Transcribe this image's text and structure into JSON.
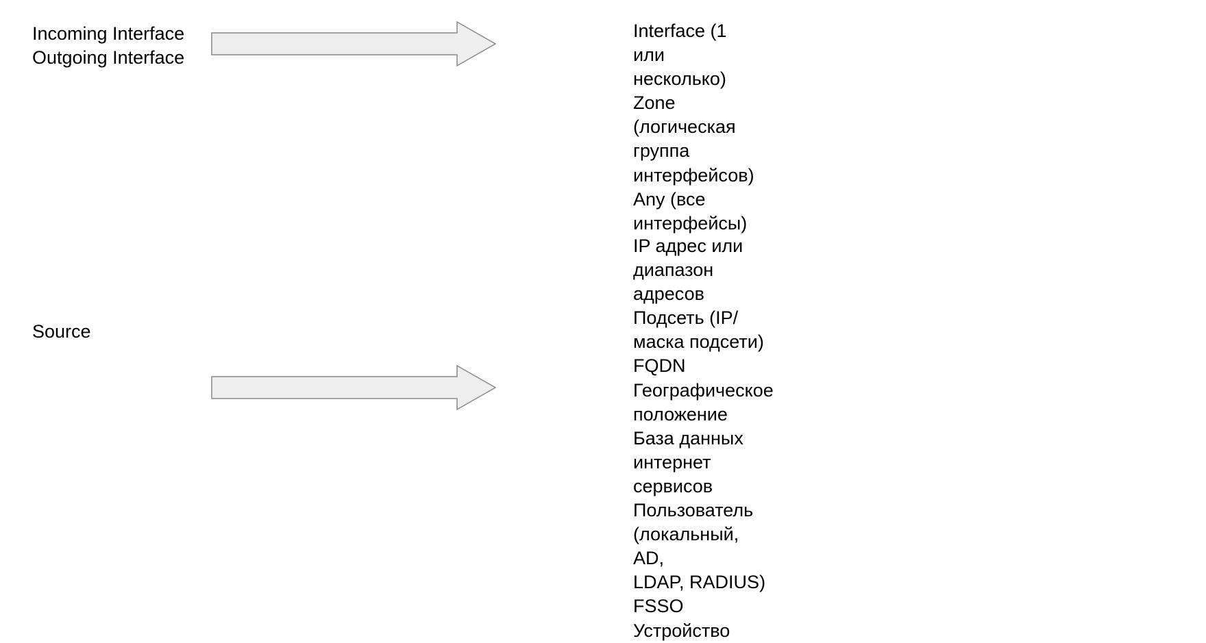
{
  "section1": {
    "left": {
      "line1": "Incoming Interface",
      "line2": "Outgoing Interface"
    },
    "right": {
      "line1": "Interface (1 или несколько)",
      "line2": "Zone (логическая группа интерфейсов)",
      "line3": "Any (все интерфейсы)"
    }
  },
  "section2": {
    "left": {
      "line1": "Source"
    },
    "right": {
      "line1": "IP адрес или диапазон адресов",
      "line2": "Подсеть (IP/маска подсети)",
      "line3": "FQDN",
      "line4": "Географическое положение",
      "line5": "База данных интернет сервисов",
      "line6": "Пользователь (локальный, AD,",
      "line7": "LDAP, RADIUS)",
      "line8": "FSSO",
      "line9": "Устройство"
    }
  },
  "colors": {
    "arrowFill": "#eeeeee",
    "arrowStroke": "#888888"
  }
}
